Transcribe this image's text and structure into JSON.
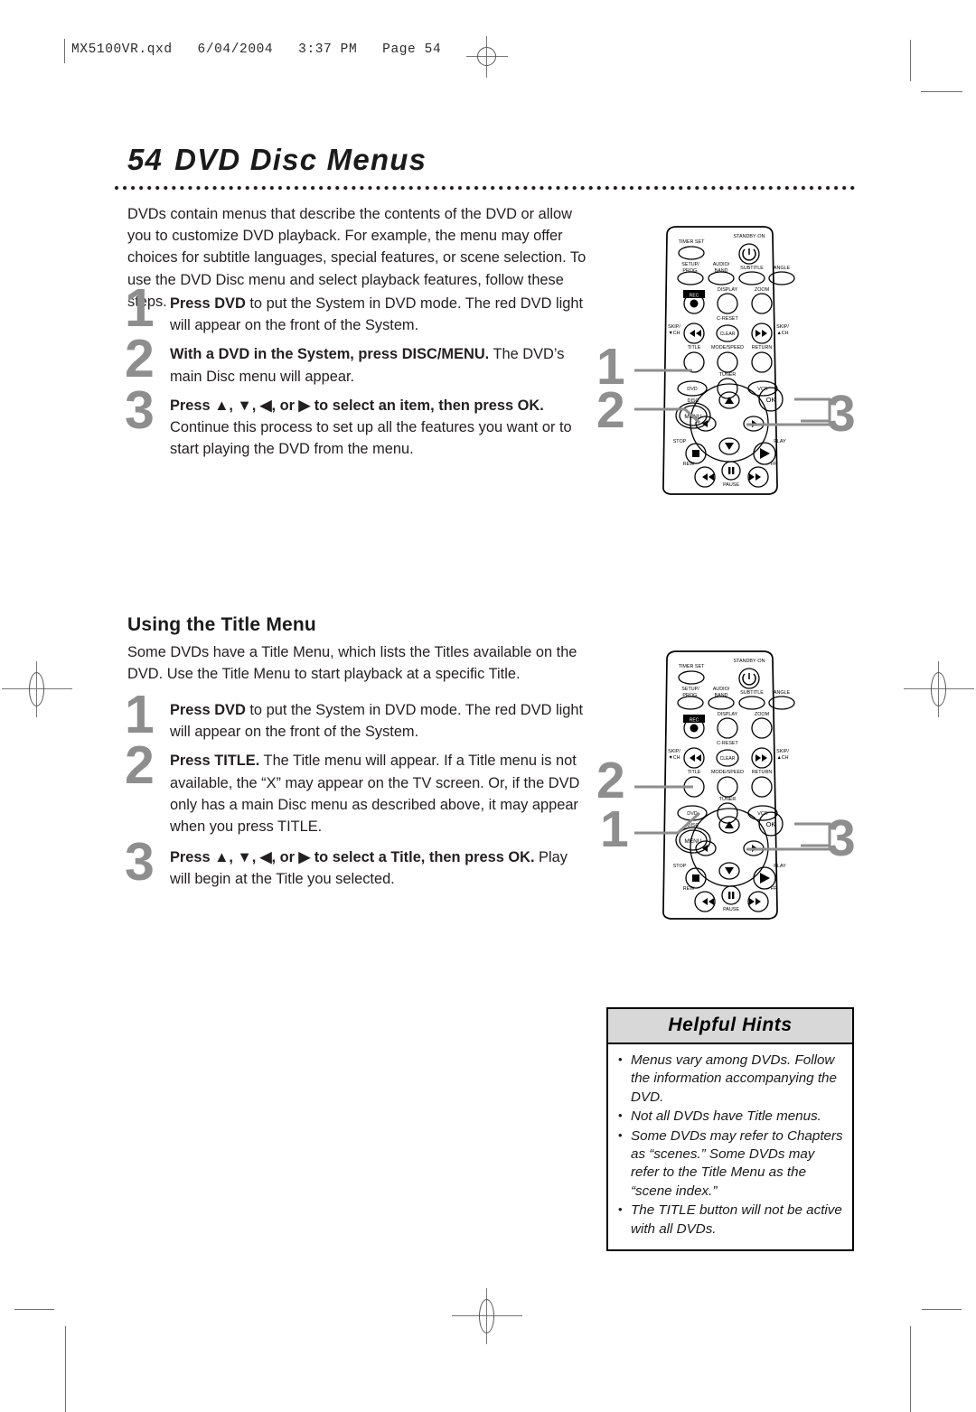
{
  "print_header": {
    "file_line": "MX5100VR.qxd   6/04/2004   3:37 PM   Page 54"
  },
  "page": {
    "number": "54",
    "title": "DVD Disc Menus",
    "intro": "DVDs contain menus that describe the contents of the DVD or allow you to customize DVD playback. For example, the menu may offer choices for subtitle languages, special features, or scene selection. To use the DVD Disc menu and select playback features, follow these steps."
  },
  "disc_menu_steps": [
    {
      "number": "1",
      "bold": "Press DVD",
      "rest": " to put the System in DVD mode. The red DVD light will appear on the front of the System."
    },
    {
      "number": "2",
      "bold": "With a DVD in the System, press DISC/MENU.",
      "rest": " The DVD’s main Disc menu will appear."
    },
    {
      "number": "3",
      "bold": "Press ▲, ▼, ◀, or ▶ to select an item, then press OK.",
      "rest": " Continue this process to set up all the features you want or to start playing the DVD from the menu."
    }
  ],
  "title_menu_section": {
    "heading": "Using the Title Menu",
    "intro": "Some DVDs have a Title Menu, which lists the Titles available on the DVD. Use the Title Menu to start playback at a specific Title.",
    "steps": [
      {
        "number": "1",
        "bold": "Press DVD",
        "rest": " to put the System in DVD mode. The red DVD light will appear on the front of the System."
      },
      {
        "number": "2",
        "bold": "Press TITLE.",
        "rest": " The Title menu will appear. If a Title menu is not available, the “X” may appear on the TV screen. Or, if the DVD only has a main Disc menu as described above, it may appear when you press TITLE."
      },
      {
        "number": "3",
        "bold": "Press ▲, ▼, ◀, or ▶ to select a Title, then press OK.",
        "rest": " Play will begin at the Title you selected."
      }
    ]
  },
  "helpful_hints": {
    "title": "Helpful Hints",
    "items": [
      "Menus vary among DVDs. Follow the information accompanying the DVD.",
      "Not all DVDs have Title menus.",
      "Some DVDs may refer to Chapters as “scenes.” Some DVDs may refer to the Title Menu as the “scene index.”",
      "The TITLE button will not be active with all DVDs."
    ]
  },
  "remote_top": {
    "callouts": [
      {
        "label": "1",
        "target": "dvd-button"
      },
      {
        "label": "2",
        "target": "disc-menu-button"
      },
      {
        "label": "3",
        "target": "navigation-pad-and-ok"
      }
    ],
    "buttons": {
      "timer_set": "TIMER SET",
      "standby_on": "STANDBY·ON",
      "setup_prog": "SETUP/\nPROG.",
      "audio_band": "AUDIO/\nBAND",
      "subtitle": "SUBTITLE",
      "angle": "ANGLE",
      "rec": "REC",
      "display": "DISPLAY",
      "zoom": "ZOOM",
      "skip_down": "SKIP/\n▼CH",
      "c_reset": "C-RESET",
      "clear": "CLEAR",
      "skip_up": "SKIP/\n▲CH",
      "title": "TITLE",
      "mode_speed": "MODE/SPEED",
      "return": "RETURN",
      "tuner": "TUNER",
      "dvd": "DVD",
      "vcr": "VCR",
      "disc": "DISC",
      "menu": "MENU",
      "ok": "OK",
      "stop": "STOP",
      "play": "PLAY",
      "rew": "REW",
      "pause": "PAUSE",
      "ff": "FF"
    }
  },
  "remote_bottom": {
    "callouts": [
      {
        "label": "2",
        "target": "title-button"
      },
      {
        "label": "1",
        "target": "dvd-button"
      },
      {
        "label": "3",
        "target": "navigation-pad-and-ok"
      }
    ]
  }
}
